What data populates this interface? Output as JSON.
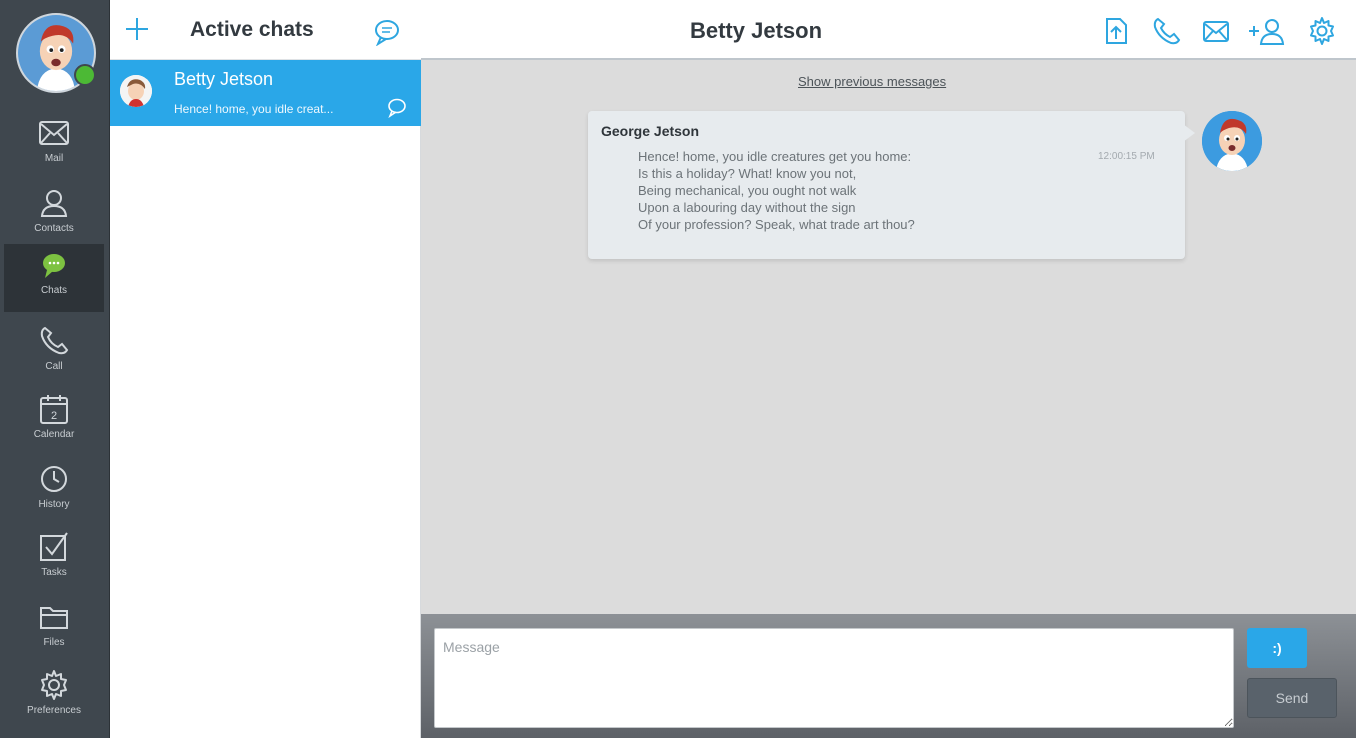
{
  "nav": {
    "items": [
      {
        "label": "Mail",
        "icon": "mail-icon"
      },
      {
        "label": "Contacts",
        "icon": "contacts-icon"
      },
      {
        "label": "Chats",
        "icon": "chats-icon",
        "active": true
      },
      {
        "label": "Call",
        "icon": "phone-icon"
      },
      {
        "label": "Calendar",
        "icon": "calendar-icon",
        "badge": "2"
      },
      {
        "label": "History",
        "icon": "clock-icon"
      },
      {
        "label": "Tasks",
        "icon": "tasks-icon"
      },
      {
        "label": "Files",
        "icon": "folder-icon"
      },
      {
        "label": "Preferences",
        "icon": "gear-icon"
      }
    ],
    "presence_color": "#4cb935"
  },
  "chats": {
    "title": "Active chats",
    "items": [
      {
        "name": "Betty Jetson",
        "preview": "Hence! home, you idle creat...",
        "selected": true
      }
    ]
  },
  "conversation": {
    "title": "Betty Jetson",
    "header_icons": [
      "share-file-icon",
      "phone-icon",
      "mail-icon",
      "add-contact-icon",
      "gear-icon"
    ],
    "show_previous": "Show previous messages",
    "messages": [
      {
        "author": "George Jetson",
        "time": "12:00:15 PM",
        "lines": [
          "Hence! home, you idle creatures get you home:",
          "Is this a holiday? What! know you not,",
          "Being mechanical, you ought not walk",
          "Upon a labouring day without the sign",
          "Of your profession? Speak, what trade art thou?"
        ]
      }
    ]
  },
  "compose": {
    "placeholder": "Message",
    "emoji_label": ":)",
    "send_label": "Send"
  },
  "colors": {
    "accent": "#2aa7e8",
    "nav_bg": "#3f474e",
    "conversation_bg": "#dcdcdc"
  }
}
